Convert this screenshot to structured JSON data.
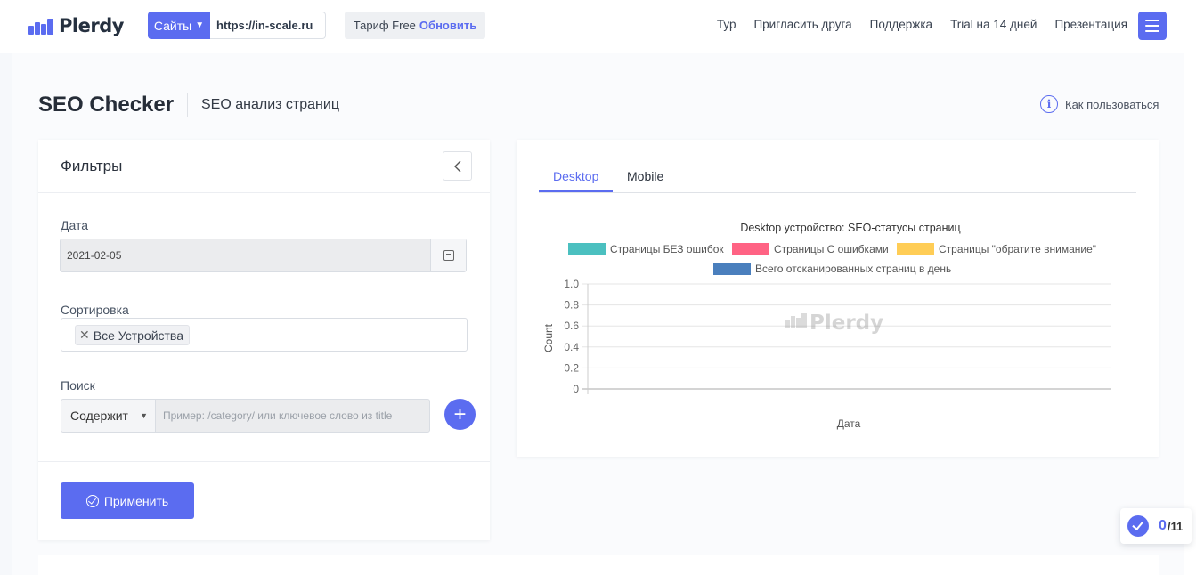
{
  "topbar": {
    "logo_text": "Plerdy",
    "sites_label": "Сайты",
    "site_url": "https://in-scale.ru",
    "tariff_label": "Тариф Free",
    "upgrade_label": "Обновить",
    "nav": [
      "Тур",
      "Пригласить друга",
      "Поддержка",
      "Trial на 14 дней",
      "Презентация"
    ],
    "brand_color": "#5b6cf0"
  },
  "page": {
    "title": "SEO Checker",
    "subtitle": "SEO анализ страниц",
    "howto_label": "Как пользоваться"
  },
  "filters": {
    "title": "Фильтры",
    "date_label": "Дата",
    "date_value": "2021-02-05",
    "sort_label": "Сортировка",
    "sort_tag": "Все Устройства",
    "search_label": "Поиск",
    "search_mode": "Содержит",
    "search_placeholder": "Пример: /category/ или ключевое слово из title",
    "apply_label": "Применить"
  },
  "tabs": [
    "Desktop",
    "Mobile"
  ],
  "chart_data": {
    "type": "line",
    "title": "Desktop устройство: SEO-статусы страниц",
    "xlabel": "Дата",
    "ylabel": "Count",
    "ylim": [
      0,
      1
    ],
    "yticks": [
      "1.0",
      "0.8",
      "0.6",
      "0.4",
      "0.2",
      "0"
    ],
    "legend_placement": "top",
    "series": [
      {
        "name": "Страницы БЕЗ ошибок",
        "color": "#4bc0c0",
        "values": []
      },
      {
        "name": "Страницы С ошибками",
        "color": "#ff6384",
        "values": []
      },
      {
        "name": "Страницы \"обратите внимание\"",
        "color": "#ffcd56",
        "values": []
      },
      {
        "name": "Всего отсканированных страниц в день",
        "color": "#4a7fbd",
        "values": []
      }
    ],
    "watermark": "Plerdy"
  },
  "progress": {
    "done": "0",
    "total": "/11"
  }
}
